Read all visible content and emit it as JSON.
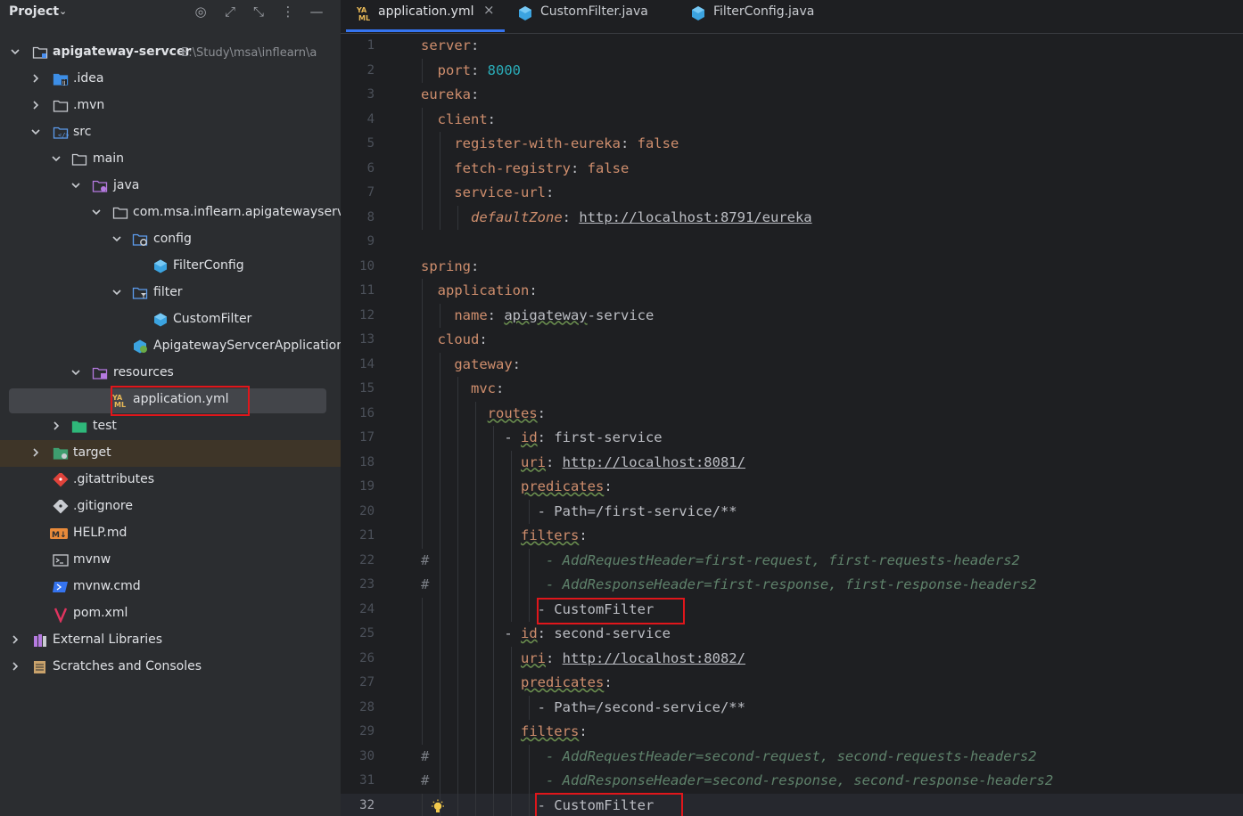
{
  "project_panel": {
    "title": "Project",
    "tree": [
      {
        "label": "apigateway-servcer",
        "hint": "E:\\Study\\msa\\inflearn\\a",
        "icon": "module-folder-icon",
        "bold": true
      },
      {
        "label": ".idea",
        "icon": "idea-folder-icon"
      },
      {
        "label": ".mvn",
        "icon": "folder-icon"
      },
      {
        "label": "src",
        "icon": "source-folder-icon"
      },
      {
        "label": "main",
        "icon": "folder-icon"
      },
      {
        "label": "java",
        "icon": "java-source-folder-icon"
      },
      {
        "label": "com.msa.inflearn.apigatewayservce",
        "icon": "package-icon"
      },
      {
        "label": "config",
        "icon": "package-config-icon"
      },
      {
        "label": "FilterConfig",
        "icon": "class-icon"
      },
      {
        "label": "filter",
        "icon": "package-filter-icon"
      },
      {
        "label": "CustomFilter",
        "icon": "class-icon"
      },
      {
        "label": "ApigatewayServcerApplication",
        "icon": "spring-app-icon"
      },
      {
        "label": "resources",
        "icon": "resources-folder-icon"
      },
      {
        "label": "application.yml",
        "icon": "yaml-file-icon"
      },
      {
        "label": "test",
        "icon": "test-folder-icon"
      },
      {
        "label": "target",
        "icon": "excluded-folder-icon"
      },
      {
        "label": ".gitattributes",
        "icon": "git-file-icon"
      },
      {
        "label": ".gitignore",
        "icon": "git-ignore-icon"
      },
      {
        "label": "HELP.md",
        "icon": "markdown-file-icon"
      },
      {
        "label": "mvnw",
        "icon": "shell-file-icon"
      },
      {
        "label": "mvnw.cmd",
        "icon": "cmd-file-icon"
      },
      {
        "label": "pom.xml",
        "icon": "maven-file-icon"
      },
      {
        "label": "External Libraries",
        "icon": "libraries-icon"
      },
      {
        "label": "Scratches and Consoles",
        "icon": "scratches-icon"
      }
    ]
  },
  "tabs": [
    {
      "label": "application.yml",
      "icon": "yaml-file-icon",
      "active": true,
      "close": "×"
    },
    {
      "label": "CustomFilter.java",
      "icon": "class-icon",
      "active": false
    },
    {
      "label": "FilterConfig.java",
      "icon": "class-icon",
      "active": false
    }
  ],
  "editor": {
    "lines": [
      {
        "n": "1",
        "parts": [
          {
            "t": "server",
            "c": "k"
          },
          {
            "t": ":",
            "c": "v"
          }
        ]
      },
      {
        "n": "2",
        "parts": [
          {
            "t": "  port",
            "c": "k"
          },
          {
            "t": ": ",
            "c": "v"
          },
          {
            "t": "8000",
            "c": "n"
          }
        ]
      },
      {
        "n": "3",
        "parts": [
          {
            "t": "eureka",
            "c": "k"
          },
          {
            "t": ":",
            "c": "v"
          }
        ]
      },
      {
        "n": "4",
        "parts": [
          {
            "t": "  client",
            "c": "k"
          },
          {
            "t": ":",
            "c": "v"
          }
        ]
      },
      {
        "n": "5",
        "parts": [
          {
            "t": "    register-with-eureka",
            "c": "k"
          },
          {
            "t": ": ",
            "c": "v"
          },
          {
            "t": "false",
            "c": "kw"
          }
        ]
      },
      {
        "n": "6",
        "parts": [
          {
            "t": "    fetch-registry",
            "c": "k"
          },
          {
            "t": ": ",
            "c": "v"
          },
          {
            "t": "false",
            "c": "kw"
          }
        ]
      },
      {
        "n": "7",
        "parts": [
          {
            "t": "    service-url",
            "c": "k"
          },
          {
            "t": ":",
            "c": "v"
          }
        ]
      },
      {
        "n": "8",
        "parts": [
          {
            "t": "      ",
            "c": "v"
          },
          {
            "t": "defaultZone",
            "c": "it"
          },
          {
            "t": ": ",
            "c": "v"
          },
          {
            "t": "http://localhost:8791/eureka",
            "c": "v u"
          }
        ]
      },
      {
        "n": "9",
        "parts": []
      },
      {
        "n": "10",
        "parts": [
          {
            "t": "spring",
            "c": "k"
          },
          {
            "t": ":",
            "c": "v"
          }
        ]
      },
      {
        "n": "11",
        "parts": [
          {
            "t": "  application",
            "c": "k"
          },
          {
            "t": ":",
            "c": "v"
          }
        ]
      },
      {
        "n": "12",
        "parts": [
          {
            "t": "    name",
            "c": "k"
          },
          {
            "t": ": ",
            "c": "v"
          },
          {
            "t": "apigateway",
            "c": "v vu"
          },
          {
            "t": "-service",
            "c": "v"
          }
        ]
      },
      {
        "n": "13",
        "parts": [
          {
            "t": "  cloud",
            "c": "k"
          },
          {
            "t": ":",
            "c": "v"
          }
        ]
      },
      {
        "n": "14",
        "parts": [
          {
            "t": "    gateway",
            "c": "k"
          },
          {
            "t": ":",
            "c": "v"
          }
        ]
      },
      {
        "n": "15",
        "parts": [
          {
            "t": "      mvc",
            "c": "k"
          },
          {
            "t": ":",
            "c": "v"
          }
        ]
      },
      {
        "n": "16",
        "parts": [
          {
            "t": "        ",
            "c": "v"
          },
          {
            "t": "routes",
            "c": "ku"
          },
          {
            "t": ":",
            "c": "v"
          }
        ]
      },
      {
        "n": "17",
        "parts": [
          {
            "t": "          - ",
            "c": "v"
          },
          {
            "t": "id",
            "c": "ku"
          },
          {
            "t": ": first-service",
            "c": "v"
          }
        ]
      },
      {
        "n": "18",
        "parts": [
          {
            "t": "            ",
            "c": "v"
          },
          {
            "t": "uri",
            "c": "ku"
          },
          {
            "t": ": ",
            "c": "v"
          },
          {
            "t": "http://localhost:8081/",
            "c": "v u"
          }
        ]
      },
      {
        "n": "19",
        "parts": [
          {
            "t": "            ",
            "c": "v"
          },
          {
            "t": "predicates",
            "c": "ku"
          },
          {
            "t": ":",
            "c": "v"
          }
        ]
      },
      {
        "n": "20",
        "parts": [
          {
            "t": "              - Path=/first-service/**",
            "c": "v"
          }
        ]
      },
      {
        "n": "21",
        "parts": [
          {
            "t": "            ",
            "c": "v"
          },
          {
            "t": "filters",
            "c": "ku"
          },
          {
            "t": ":",
            "c": "v"
          }
        ]
      },
      {
        "n": "22",
        "hash": "#",
        "parts": [
          {
            "t": "               - AddRequestHeader=first-request, first-requests-headers2",
            "c": "cm"
          }
        ]
      },
      {
        "n": "23",
        "hash": "#",
        "parts": [
          {
            "t": "               - AddResponseHeader=first-response, first-response-headers2",
            "c": "cm"
          }
        ]
      },
      {
        "n": "24",
        "parts": [
          {
            "t": "              - CustomFilter",
            "c": "v"
          }
        ]
      },
      {
        "n": "25",
        "parts": [
          {
            "t": "          - ",
            "c": "v"
          },
          {
            "t": "id",
            "c": "ku"
          },
          {
            "t": ": second-service",
            "c": "v"
          }
        ]
      },
      {
        "n": "26",
        "parts": [
          {
            "t": "            ",
            "c": "v"
          },
          {
            "t": "uri",
            "c": "ku"
          },
          {
            "t": ": ",
            "c": "v"
          },
          {
            "t": "http://localhost:8082/",
            "c": "v u"
          }
        ]
      },
      {
        "n": "27",
        "parts": [
          {
            "t": "            ",
            "c": "v"
          },
          {
            "t": "predicates",
            "c": "ku"
          },
          {
            "t": ":",
            "c": "v"
          }
        ]
      },
      {
        "n": "28",
        "parts": [
          {
            "t": "              - Path=/second-service/**",
            "c": "v"
          }
        ]
      },
      {
        "n": "29",
        "parts": [
          {
            "t": "            ",
            "c": "v"
          },
          {
            "t": "filters",
            "c": "ku"
          },
          {
            "t": ":",
            "c": "v"
          }
        ]
      },
      {
        "n": "30",
        "hash": "#",
        "parts": [
          {
            "t": "               - AddRequestHeader=second-request, second-requests-headers2",
            "c": "cm"
          }
        ]
      },
      {
        "n": "31",
        "hash": "#",
        "parts": [
          {
            "t": "               - AddResponseHeader=second-response, second-response-headers2",
            "c": "cm"
          }
        ]
      },
      {
        "n": "32",
        "parts": [
          {
            "t": "              - CustomFilter",
            "c": "v"
          }
        ],
        "current": true,
        "bulb": "lightbulb-icon"
      }
    ]
  },
  "colors": {
    "yaml_key": "#cf8e6d",
    "number": "#2aacb8",
    "text": "#bcbec4",
    "comment": "#5f826b",
    "highlight_box": "#e0161b",
    "tab_underline": "#3574f0"
  }
}
